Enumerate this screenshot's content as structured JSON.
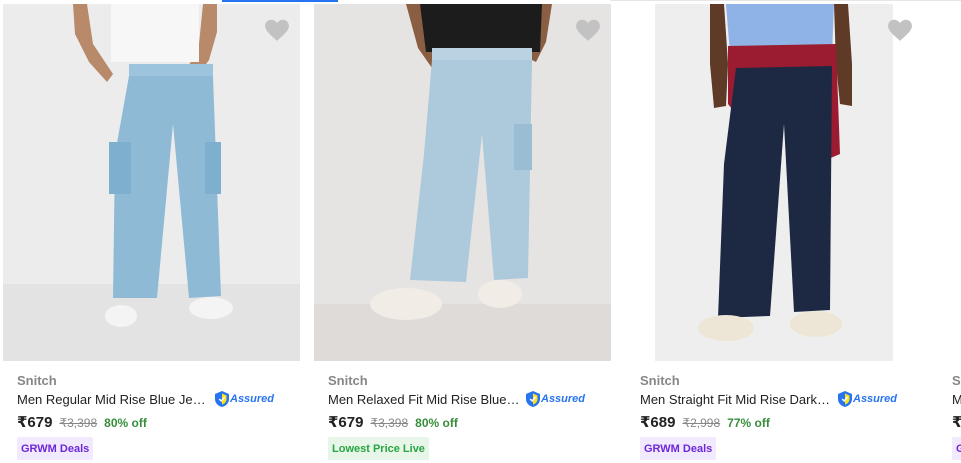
{
  "products": [
    {
      "brand": "Snitch",
      "title": "Men Regular Mid Rise Blue Jeans",
      "assured": "Assured",
      "price": "₹679",
      "mrp": "₹3,398",
      "discount": "80% off",
      "tag": "GRWM Deals",
      "tag_style": "purple",
      "image": "light-blue-cargo-jeans-white-tee"
    },
    {
      "brand": "Snitch",
      "title": "Men Relaxed Fit Mid Rise Blue J...",
      "assured": "Assured",
      "price": "₹679",
      "mrp": "₹3,398",
      "discount": "80% off",
      "tag": "Lowest Price Live",
      "tag_style": "green",
      "image": "light-blue-cargo-jeans-black-tee"
    },
    {
      "brand": "Snitch",
      "title": "Men Straight Fit Mid Rise Dark Bl...",
      "assured": "Assured",
      "price": "₹689",
      "mrp": "₹2,998",
      "discount": "77% off",
      "tag": "GRWM Deals",
      "tag_style": "purple",
      "image": "dark-blue-jeans-red-sweater"
    },
    {
      "brand": "Sn",
      "title": "M",
      "price": "₹6",
      "tag": "G",
      "tag_style": "purple",
      "image": "partially-visible"
    }
  ],
  "icons": {
    "wishlist": "heart-icon",
    "assured_badge": "shield-icon"
  },
  "colors": {
    "accent": "#2874f0",
    "discount_green": "#388e3c",
    "grwm_purple": "#6d27d9",
    "lowest_price_green": "#26a541"
  }
}
